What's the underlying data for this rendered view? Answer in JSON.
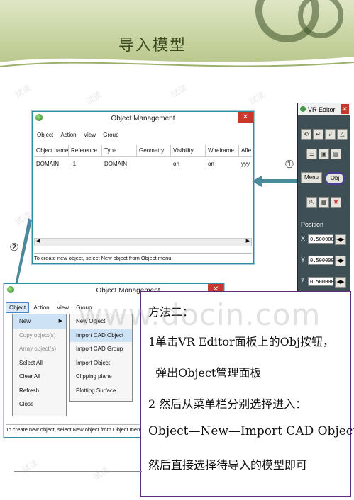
{
  "slide": {
    "title": "导入模型"
  },
  "watermark": {
    "text": "试读",
    "url": "www.docin.com"
  },
  "window1": {
    "title": "Object Management",
    "close": "✕",
    "menu": [
      "Object",
      "Action",
      "View",
      "Group"
    ],
    "columns": [
      "Object name",
      "Reference",
      "Type",
      "Geometry",
      "Visibility",
      "Wireframe",
      "Affe"
    ],
    "rows": [
      [
        "DOMAIN",
        "-1",
        "DOMAIN",
        "",
        "on",
        "on",
        "yyy"
      ]
    ],
    "status": "To create new object, select New object from Object menu"
  },
  "window2": {
    "title": "Object Management",
    "close": "✕",
    "menu": [
      "Object",
      "Action",
      "View",
      "Group"
    ],
    "status": "To create new object, select New object from Object menu",
    "object_menu": [
      {
        "label": "New",
        "disabled": false,
        "submenu": true
      },
      {
        "label": "Copy object(s)",
        "disabled": true
      },
      {
        "label": "Array object(s)",
        "disabled": true
      },
      {
        "label": "Select All",
        "disabled": false
      },
      {
        "label": "Clear All",
        "disabled": false
      },
      {
        "label": "Refresh",
        "disabled": false
      },
      {
        "label": "Close",
        "disabled": false
      }
    ],
    "new_submenu": [
      "New Object",
      "Import CAD Object",
      "Import CAD Group",
      "Import Object",
      "Clipping plane",
      "Plotting Surface"
    ],
    "selected_submenu_item": "Import CAD Object"
  },
  "vr_editor": {
    "title": "VR Editor",
    "close": "✕",
    "menu_button": "Menu",
    "obj_button": "Obj",
    "position_label": "Position",
    "axes": [
      {
        "axis": "X",
        "value": "0.500000"
      },
      {
        "axis": "Y",
        "value": "0.500000"
      },
      {
        "axis": "Z",
        "value": "0.500000"
      }
    ]
  },
  "markers": {
    "one": "①",
    "two": "②"
  },
  "callout": {
    "lines": [
      "方法二：",
      "1单击VR Editor面板上的Obj按钮，",
      "  弹出Object管理面板",
      "2 然后从菜单栏分别选择进入：",
      "Object—New—Import CAD Object",
      "然后直接选择待导入的模型即可"
    ]
  },
  "colors": {
    "header_green": "#c7d3a0",
    "callout_border": "#5b2f7c",
    "arrow": "#4a8a9a",
    "close_red": "#c8372b"
  }
}
